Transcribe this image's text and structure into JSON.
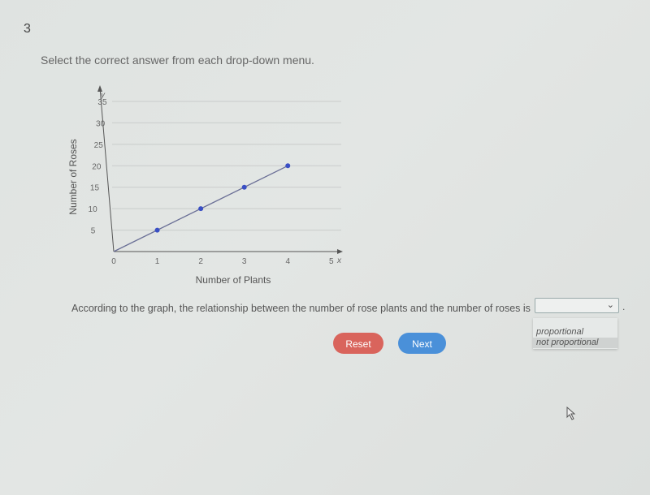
{
  "question_number": "3",
  "instruction": "Select the correct answer from each drop-down menu.",
  "chart_data": {
    "type": "scatter",
    "title": "",
    "xlabel": "Number of Plants",
    "ylabel": "Number of Roses",
    "x_axis_letter": "x",
    "y_axis_letter": "y",
    "xlim": [
      0,
      5
    ],
    "ylim": [
      0,
      35
    ],
    "x_ticks": [
      0,
      1,
      2,
      3,
      4,
      5
    ],
    "y_ticks": [
      5,
      10,
      15,
      20,
      25,
      30,
      35
    ],
    "grid": true,
    "line_through_origin": true,
    "points": [
      {
        "x": 1,
        "y": 5
      },
      {
        "x": 2,
        "y": 10
      },
      {
        "x": 3,
        "y": 15
      },
      {
        "x": 4,
        "y": 20
      }
    ],
    "point_color": "#3a4fc4",
    "line_color": "#6a6f96"
  },
  "question_text": "According to the graph, the relationship between the number of rose plants and the number of roses is",
  "dropdown": {
    "selected": "",
    "options": [
      "proportional",
      "not proportional"
    ],
    "highlighted": "not proportional"
  },
  "period": ".",
  "buttons": {
    "reset": "Reset",
    "next": "Next"
  },
  "colors": {
    "reset": "#d9645c",
    "next": "#4a90d9"
  }
}
